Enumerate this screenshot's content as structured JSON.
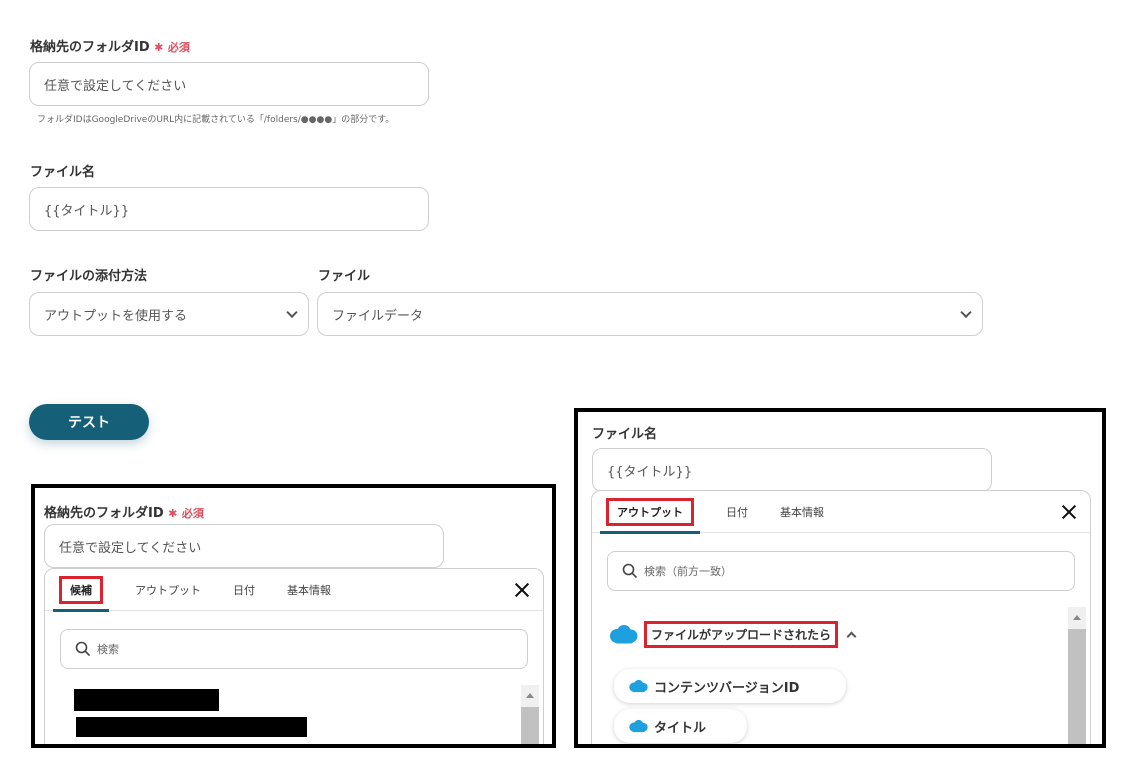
{
  "form": {
    "folder_id": {
      "label": "格納先のフォルダID",
      "required_mark": "✱",
      "required_text": "必須",
      "placeholder": "任意で設定してください",
      "hint": "フォルダIDはGoogleDriveのURL内に記載されている「/folders/●●●●」の部分です。"
    },
    "file_name": {
      "label": "ファイル名",
      "value": "{{タイトル}}"
    },
    "attach_method": {
      "label": "ファイルの添付方法",
      "value": "アウトプットを使用する"
    },
    "file": {
      "label": "ファイル",
      "value": "ファイルデータ"
    },
    "test_button": "テスト"
  },
  "left_panel": {
    "label": "格納先のフォルダID",
    "required_mark": "✱",
    "required_text": "必須",
    "placeholder": "任意で設定してください",
    "tabs": [
      "候補",
      "アウトプット",
      "日付",
      "基本情報"
    ],
    "active_tab": "候補",
    "search_placeholder": "検索"
  },
  "right_panel": {
    "label": "ファイル名",
    "value": "{{タイトル}}",
    "tabs": [
      "アウトプット",
      "日付",
      "基本情報"
    ],
    "active_tab": "アウトプット",
    "search_placeholder": "検索（前方一致）",
    "group_title": "ファイルがアップロードされたら",
    "items": [
      "コンテンツバージョンID",
      "タイトル"
    ]
  },
  "colors": {
    "accent": "#155f78",
    "required": "#e04e5c",
    "highlight": "#d9232e",
    "salesforce": "#1ea0de"
  },
  "icons": {
    "search": "search-icon",
    "close": "close-icon",
    "chevron": "chevron-down-icon",
    "cloud": "salesforce-cloud-icon"
  }
}
